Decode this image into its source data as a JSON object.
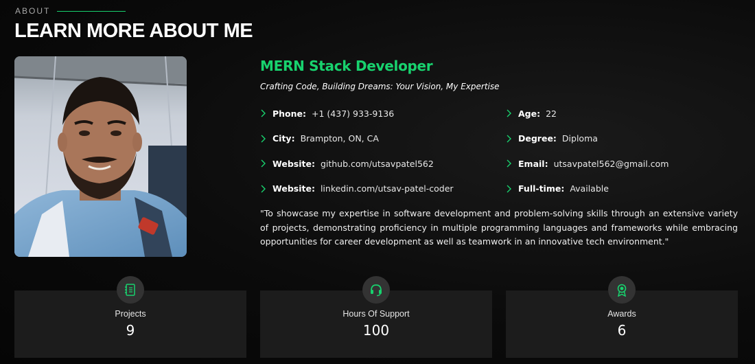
{
  "section": {
    "label": "ABOUT",
    "title": "LEARN MORE ABOUT ME"
  },
  "profile": {
    "role": "MERN Stack Developer",
    "tagline": "Crafting Code, Building Dreams: Your Vision, My Expertise",
    "info_left": [
      {
        "key": "Phone:",
        "value": "+1 (437) 933-9136"
      },
      {
        "key": "City:",
        "value": "Brampton, ON, CA"
      },
      {
        "key": "Website:",
        "value": "github.com/utsavpatel562"
      },
      {
        "key": "Website:",
        "value": "linkedin.com/utsav-patel-coder"
      }
    ],
    "info_right": [
      {
        "key": "Age:",
        "value": "22"
      },
      {
        "key": "Degree:",
        "value": "Diploma"
      },
      {
        "key": "Email:",
        "value": "utsavpatel562@gmail.com"
      },
      {
        "key": "Full-time:",
        "value": "Available"
      }
    ],
    "quote": "\"To showcase my expertise in software development and problem-solving skills through an extensive variety of projects, demonstrating proficiency in multiple programming languages and frameworks while embracing opportunities for career development as well as teamwork in an innovative tech environment.\""
  },
  "stats": [
    {
      "label": "Projects",
      "value": "9",
      "icon": "journal-icon"
    },
    {
      "label": "Hours Of Support",
      "value": "100",
      "icon": "headset-icon"
    },
    {
      "label": "Awards",
      "value": "6",
      "icon": "award-icon"
    }
  ],
  "colors": {
    "accent": "#18d26e",
    "background": "#080808",
    "card": "#1c1c1c"
  }
}
